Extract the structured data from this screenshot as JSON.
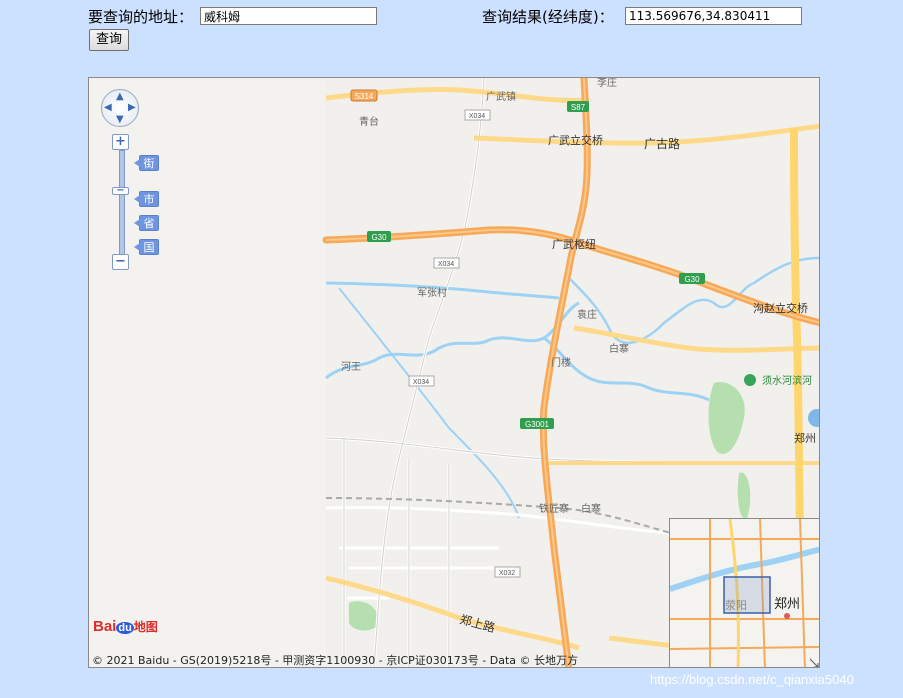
{
  "form": {
    "address_label": "要查询的地址：",
    "address_value": "威科姆",
    "result_label": "查询结果(经纬度)：",
    "result_value": "113.569676,34.830411",
    "query_button": "查询"
  },
  "map": {
    "zoom_levels": [
      "街",
      "市",
      "省",
      "国"
    ],
    "zoom_in": "+",
    "zoom_out": "−",
    "places": {
      "s314": "S314",
      "guangwu_town": "广武镇",
      "lizhuang": "李庄",
      "x034_top": "X034",
      "s87": "S87",
      "qingtai": "青台",
      "guangwu_bridge": "广武立交桥",
      "guanggu_road": "广古路",
      "g30_left": "G30",
      "guangwu_hub": "广武枢纽",
      "x034_mid": "X034",
      "g30_right": "G30",
      "junzhang": "军张村",
      "yuanzhuang": "袁庄",
      "gouzhao_bridge": "沟赵立交桥",
      "baizhai": "白寨",
      "hewang": "河王",
      "menlou": "门楼",
      "x034_low": "X034",
      "xushui_park": "须水河滨河",
      "g3001": "G3001",
      "zhengzhou_city": "郑州",
      "tiejiangzhai": "铁匠寨",
      "baizhai2": "白寨",
      "x032": "X032",
      "zhengshang_road": "郑上路"
    },
    "overview": {
      "xingyang": "荥阳",
      "zhengzhou": "郑州"
    },
    "logo": {
      "bai": "Bai",
      "du": "du",
      "ditu": "地图"
    },
    "copyright": "© 2021 Baidu - GS(2019)5218号 - 甲测资字1100930 - 京ICP证030173号 - Data © 长地万方"
  },
  "watermark": "https://blog.csdn.net/c_qianxia5040",
  "colors": {
    "page_bg": "#cce0ff",
    "highway": "#f6a95a",
    "expressway_yellow": "#ffd66e",
    "water": "#9ed2f5",
    "park": "#b6dfb0"
  }
}
